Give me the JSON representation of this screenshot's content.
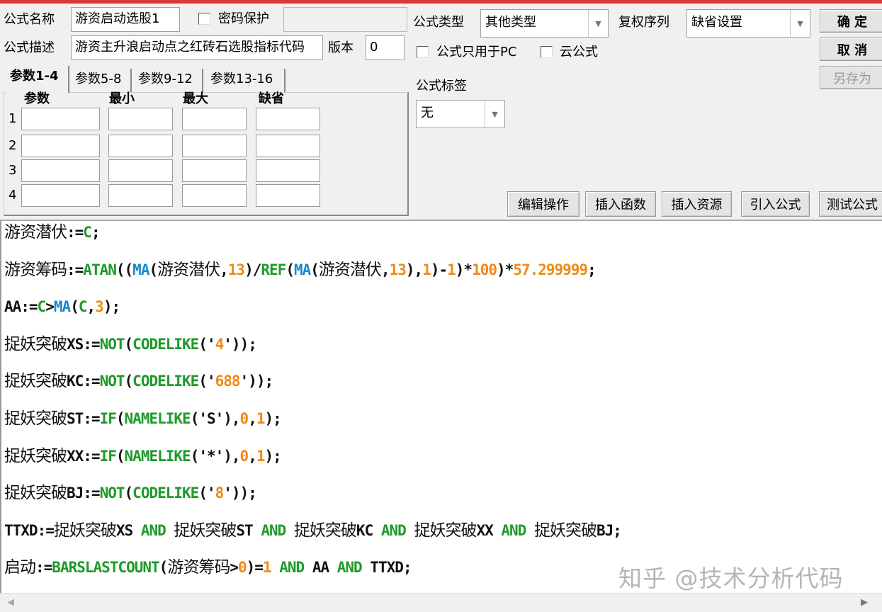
{
  "form": {
    "name_label": "公式名称",
    "name_value": "游资启动选股1",
    "password_label": "密码保护",
    "password_value": "",
    "desc_label": "公式描述",
    "desc_value": "游资主升浪启动点之红砖石选股指标代码",
    "version_label": "版本",
    "version_value": "0",
    "type_label": "公式类型",
    "type_value": "其他类型",
    "rights_label": "复权序列",
    "rights_value": "缺省设置",
    "pc_only_label": "公式只用于PC",
    "cloud_label": "云公式",
    "tag_label": "公式标签",
    "tag_value": "无"
  },
  "buttons": {
    "ok": "确 定",
    "cancel": "取 消",
    "save_as": "另存为",
    "edit": "编辑操作",
    "insert_func": "插入函数",
    "insert_res": "插入资源",
    "import": "引入公式",
    "test": "测试公式"
  },
  "tabs": [
    "参数1-4",
    "参数5-8",
    "参数9-12",
    "参数13-16"
  ],
  "param_headers": [
    "参数",
    "最小",
    "最大",
    "缺省"
  ],
  "param_rows": [
    "1",
    "2",
    "3",
    "4"
  ],
  "code": {
    "lines": [
      [
        [
          "游资潜伏",
          "c"
        ],
        [
          ":=",
          "t"
        ],
        [
          "C",
          "f"
        ],
        [
          ";",
          "t"
        ]
      ],
      [
        [
          "游资筹码",
          "c"
        ],
        [
          ":=",
          "t"
        ],
        [
          "ATAN",
          "f"
        ],
        [
          "((",
          "t"
        ],
        [
          "MA",
          "m"
        ],
        [
          "(",
          "t"
        ],
        [
          "游资潜伏",
          "c"
        ],
        [
          ",",
          "t"
        ],
        [
          "13",
          "n"
        ],
        [
          ")/",
          "t"
        ],
        [
          "REF",
          "f"
        ],
        [
          "(",
          "t"
        ],
        [
          "MA",
          "m"
        ],
        [
          "(",
          "t"
        ],
        [
          "游资潜伏",
          "c"
        ],
        [
          ",",
          "t"
        ],
        [
          "13",
          "n"
        ],
        [
          "),",
          "t"
        ],
        [
          "1",
          "n"
        ],
        [
          ")-",
          "t"
        ],
        [
          "1",
          "n"
        ],
        [
          ")*",
          "t"
        ],
        [
          "100",
          "n"
        ],
        [
          ")*",
          "t"
        ],
        [
          "57.299999",
          "n"
        ],
        [
          ";",
          "t"
        ]
      ],
      [
        [
          "AA:=",
          "t"
        ],
        [
          "C",
          "f"
        ],
        [
          ">",
          "t"
        ],
        [
          "MA",
          "m"
        ],
        [
          "(",
          "t"
        ],
        [
          "C",
          "f"
        ],
        [
          ",",
          "t"
        ],
        [
          "3",
          "n"
        ],
        [
          ");",
          "t"
        ]
      ],
      [
        [
          "捉妖突破",
          "c"
        ],
        [
          "XS:=",
          "t"
        ],
        [
          "NOT",
          "f"
        ],
        [
          "(",
          "t"
        ],
        [
          "CODELIKE",
          "f"
        ],
        [
          "('",
          "t"
        ],
        [
          "4",
          "n"
        ],
        [
          "'));",
          "t"
        ]
      ],
      [
        [
          "捉妖突破",
          "c"
        ],
        [
          "KC:=",
          "t"
        ],
        [
          "NOT",
          "f"
        ],
        [
          "(",
          "t"
        ],
        [
          "CODELIKE",
          "f"
        ],
        [
          "('",
          "t"
        ],
        [
          "688",
          "n"
        ],
        [
          "'));",
          "t"
        ]
      ],
      [
        [
          "捉妖突破",
          "c"
        ],
        [
          "ST:=",
          "t"
        ],
        [
          "IF",
          "f"
        ],
        [
          "(",
          "t"
        ],
        [
          "NAMELIKE",
          "f"
        ],
        [
          "('S'),",
          "t"
        ],
        [
          "0",
          "n"
        ],
        [
          ",",
          "t"
        ],
        [
          "1",
          "n"
        ],
        [
          ");",
          "t"
        ]
      ],
      [
        [
          "捉妖突破",
          "c"
        ],
        [
          "XX:=",
          "t"
        ],
        [
          "IF",
          "f"
        ],
        [
          "(",
          "t"
        ],
        [
          "NAMELIKE",
          "f"
        ],
        [
          "('*'),",
          "t"
        ],
        [
          "0",
          "n"
        ],
        [
          ",",
          "t"
        ],
        [
          "1",
          "n"
        ],
        [
          ");",
          "t"
        ]
      ],
      [
        [
          "捉妖突破",
          "c"
        ],
        [
          "BJ:=",
          "t"
        ],
        [
          "NOT",
          "f"
        ],
        [
          "(",
          "t"
        ],
        [
          "CODELIKE",
          "f"
        ],
        [
          "('",
          "t"
        ],
        [
          "8",
          "n"
        ],
        [
          "'));",
          "t"
        ]
      ],
      [
        [
          "TTXD:=",
          "t"
        ],
        [
          "捉妖突破",
          "c"
        ],
        [
          "XS ",
          "t"
        ],
        [
          "AND",
          "f"
        ],
        [
          " ",
          "t"
        ],
        [
          "捉妖突破",
          "c"
        ],
        [
          "ST ",
          "t"
        ],
        [
          "AND",
          "f"
        ],
        [
          " ",
          "t"
        ],
        [
          "捉妖突破",
          "c"
        ],
        [
          "KC ",
          "t"
        ],
        [
          "AND",
          "f"
        ],
        [
          " ",
          "t"
        ],
        [
          "捉妖突破",
          "c"
        ],
        [
          "XX ",
          "t"
        ],
        [
          "AND",
          "f"
        ],
        [
          " ",
          "t"
        ],
        [
          "捉妖突破",
          "c"
        ],
        [
          "BJ;",
          "t"
        ]
      ],
      [
        [
          "启动",
          "c"
        ],
        [
          ":=",
          "t"
        ],
        [
          "BARSLASTCOUNT",
          "f"
        ],
        [
          "(",
          "t"
        ],
        [
          "游资筹码",
          "c"
        ],
        [
          ">",
          "t"
        ],
        [
          "0",
          "n"
        ],
        [
          ")=",
          "t"
        ],
        [
          "1",
          "n"
        ],
        [
          " ",
          "t"
        ],
        [
          "AND",
          "f"
        ],
        [
          " AA ",
          "t"
        ],
        [
          "AND",
          "f"
        ],
        [
          " TTXD;",
          "t"
        ]
      ]
    ]
  },
  "watermark": "知乎 @技术分析代码",
  "colors": {
    "keyword": "#1e9a2a",
    "ma": "#1a88cc",
    "number": "#f08a18",
    "topbar": "#d9383a"
  }
}
